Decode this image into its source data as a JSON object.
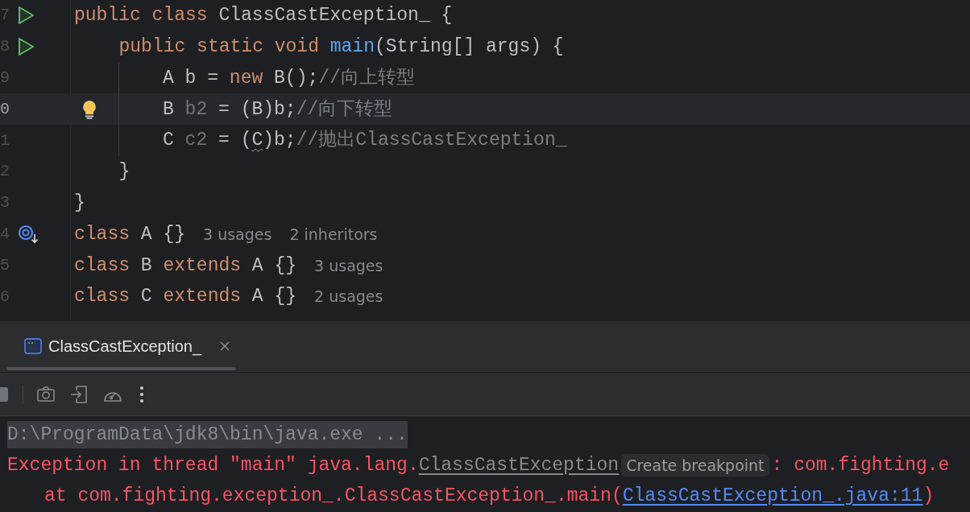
{
  "editor": {
    "lines": [
      {
        "number": "7",
        "kind": "runnable",
        "current": false,
        "intention_bulb": false,
        "tokens": [
          {
            "kind": "keyword",
            "text": "public class "
          },
          {
            "kind": "plain",
            "text": "ClassCastException_ {"
          }
        ],
        "children": [
          {
            "number": "8",
            "kind": "runnable",
            "current": false,
            "intention_bulb": false,
            "tokens": [
              {
                "kind": "keyword",
                "text": "public static void "
              },
              {
                "kind": "method",
                "text": "main"
              },
              {
                "kind": "plain",
                "text": "(String[] args) {"
              }
            ],
            "children": [
              {
                "number": "9",
                "current": false,
                "intention_bulb": false,
                "tokens": [
                  {
                    "kind": "plain",
                    "text": "A b = "
                  },
                  {
                    "kind": "keyword",
                    "text": "new "
                  },
                  {
                    "kind": "plain",
                    "text": "B();"
                  },
                  {
                    "kind": "comment",
                    "text": "//向上转型"
                  }
                ]
              },
              {
                "number": "0",
                "current": true,
                "intention_bulb": true,
                "tokens": [
                  {
                    "kind": "plain",
                    "text": "B "
                  },
                  {
                    "kind": "unused",
                    "text": "b2"
                  },
                  {
                    "kind": "plain",
                    "text": " = (B)b;"
                  },
                  {
                    "kind": "comment",
                    "text": "//向下转型"
                  }
                ]
              },
              {
                "number": "1",
                "current": false,
                "intention_bulb": false,
                "tokens": [
                  {
                    "kind": "plain",
                    "text": "C "
                  },
                  {
                    "kind": "unused",
                    "text": "c2"
                  },
                  {
                    "kind": "plain",
                    "text": " = ("
                  },
                  {
                    "kind": "warning",
                    "text": "C"
                  },
                  {
                    "kind": "plain",
                    "text": ")b;"
                  },
                  {
                    "kind": "comment",
                    "text": "//抛出ClassCastException_"
                  }
                ]
              }
            ]
          },
          {
            "number": "2",
            "current": false,
            "intention_bulb": false,
            "tokens": [
              {
                "kind": "plain",
                "text": "}"
              }
            ]
          }
        ]
      },
      {
        "number": "3",
        "current": false,
        "intention_bulb": false,
        "tokens": [
          {
            "kind": "plain",
            "text": "}"
          }
        ]
      },
      {
        "number": "4",
        "kind": "implemented",
        "current": false,
        "intention_bulb": false,
        "tokens": [
          {
            "kind": "keyword",
            "text": "class "
          },
          {
            "kind": "plain",
            "text": "A {}"
          },
          {
            "kind": "hint",
            "text": "3 usages"
          },
          {
            "kind": "hint",
            "text": "2 inheritors"
          }
        ]
      },
      {
        "number": "5",
        "current": false,
        "intention_bulb": false,
        "tokens": [
          {
            "kind": "keyword",
            "text": "class "
          },
          {
            "kind": "plain",
            "text": "B "
          },
          {
            "kind": "keyword",
            "text": "extends "
          },
          {
            "kind": "plain",
            "text": "A {}"
          },
          {
            "kind": "hint",
            "text": "3 usages"
          }
        ]
      },
      {
        "number": "6",
        "current": false,
        "intention_bulb": false,
        "tokens": [
          {
            "kind": "keyword",
            "text": "class "
          },
          {
            "kind": "plain",
            "text": "C "
          },
          {
            "kind": "keyword",
            "text": "extends "
          },
          {
            "kind": "plain",
            "text": "A {}"
          },
          {
            "kind": "hint",
            "text": "2 usages"
          }
        ]
      }
    ]
  },
  "run_panel": {
    "tabs": [
      {
        "label": "ClassCastException_",
        "selected": true
      }
    ],
    "console": [
      {
        "kind": "command",
        "segments": [
          {
            "kind": "command",
            "text": "D:\\ProgramData\\jdk8\\bin\\java.exe ..."
          }
        ]
      },
      {
        "kind": "error",
        "segments": [
          {
            "kind": "error",
            "text": "Exception in thread \"main\" java.lang."
          },
          {
            "kind": "class_link",
            "text": "ClassCastException"
          },
          {
            "kind": "inlay",
            "text": "Create breakpoint"
          },
          {
            "kind": "error",
            "text": ": com.fighting.e"
          }
        ]
      },
      {
        "kind": "stack_frame",
        "segments": [
          {
            "kind": "error",
            "text": "at com.fighting.exception_.ClassCastException_.main("
          },
          {
            "kind": "file_link",
            "text": "ClassCastException_.java:11"
          },
          {
            "kind": "error",
            "text": ")"
          }
        ]
      }
    ]
  }
}
